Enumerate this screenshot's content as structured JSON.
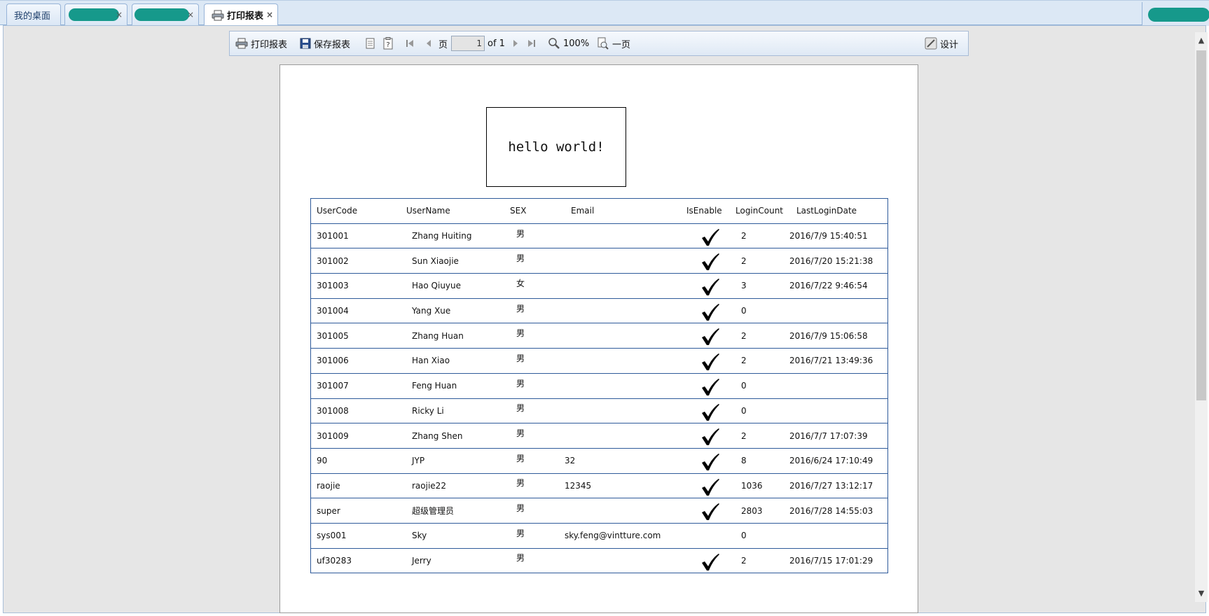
{
  "tabs": [
    {
      "label": "我的桌面",
      "closable": false,
      "active": false
    },
    {
      "label": "",
      "closable": true,
      "active": false,
      "redacted": true
    },
    {
      "label": "",
      "closable": true,
      "active": false,
      "redacted": true
    },
    {
      "label": "打印报表",
      "closable": true,
      "active": true
    }
  ],
  "toolbar": {
    "print_label": "打印报表",
    "save_label": "保存报表",
    "page_label": "页",
    "page_value": "1",
    "page_of": "of 1",
    "zoom_label": "100%",
    "one_page_label": "一页",
    "design_label": "设计"
  },
  "report": {
    "title": "hello world!",
    "columns": [
      "UserCode",
      "UserName",
      "SEX",
      "Email",
      "IsEnable",
      "LoginCount",
      "LastLoginDate"
    ],
    "rows": [
      {
        "code": "301001",
        "name": "Zhang Huiting",
        "sex": "男",
        "email": "",
        "enabled": true,
        "count": "2",
        "last": "2016/7/9 15:40:51"
      },
      {
        "code": "301002",
        "name": "Sun Xiaojie",
        "sex": "男",
        "email": "",
        "enabled": true,
        "count": "2",
        "last": "2016/7/20 15:21:38"
      },
      {
        "code": "301003",
        "name": "Hao Qiuyue",
        "sex": "女",
        "email": "",
        "enabled": true,
        "count": "3",
        "last": "2016/7/22 9:46:54"
      },
      {
        "code": "301004",
        "name": "Yang Xue",
        "sex": "男",
        "email": "",
        "enabled": true,
        "count": "0",
        "last": ""
      },
      {
        "code": "301005",
        "name": "Zhang Huan",
        "sex": "男",
        "email": "",
        "enabled": true,
        "count": "2",
        "last": "2016/7/9 15:06:58"
      },
      {
        "code": "301006",
        "name": "Han Xiao",
        "sex": "男",
        "email": "",
        "enabled": true,
        "count": "2",
        "last": "2016/7/21 13:49:36"
      },
      {
        "code": "301007",
        "name": "Feng Huan",
        "sex": "男",
        "email": "",
        "enabled": true,
        "count": "0",
        "last": ""
      },
      {
        "code": "301008",
        "name": "Ricky Li",
        "sex": "男",
        "email": "",
        "enabled": true,
        "count": "0",
        "last": ""
      },
      {
        "code": "301009",
        "name": "Zhang Shen",
        "sex": "男",
        "email": "",
        "enabled": true,
        "count": "2",
        "last": "2016/7/7 17:07:39"
      },
      {
        "code": "90",
        "name": "JYP",
        "sex": "男",
        "email": "32",
        "enabled": true,
        "count": "8",
        "last": "2016/6/24 17:10:49"
      },
      {
        "code": "raojie",
        "name": "raojie22",
        "sex": "男",
        "email": "12345",
        "enabled": true,
        "count": "1036",
        "last": "2016/7/27 13:12:17"
      },
      {
        "code": "super",
        "name": "超级管理员",
        "sex": "男",
        "email": "",
        "enabled": true,
        "count": "2803",
        "last": "2016/7/28 14:55:03"
      },
      {
        "code": "sys001",
        "name": "Sky",
        "sex": "男",
        "email": "sky.feng@vintture.com",
        "enabled": false,
        "count": "0",
        "last": ""
      },
      {
        "code": "uf30283",
        "name": "Jerry",
        "sex": "男",
        "email": "",
        "enabled": true,
        "count": "2",
        "last": "2016/7/15 17:01:29"
      }
    ]
  },
  "colors": {
    "accent": "#2e5a9a",
    "redaction": "#16998b"
  }
}
